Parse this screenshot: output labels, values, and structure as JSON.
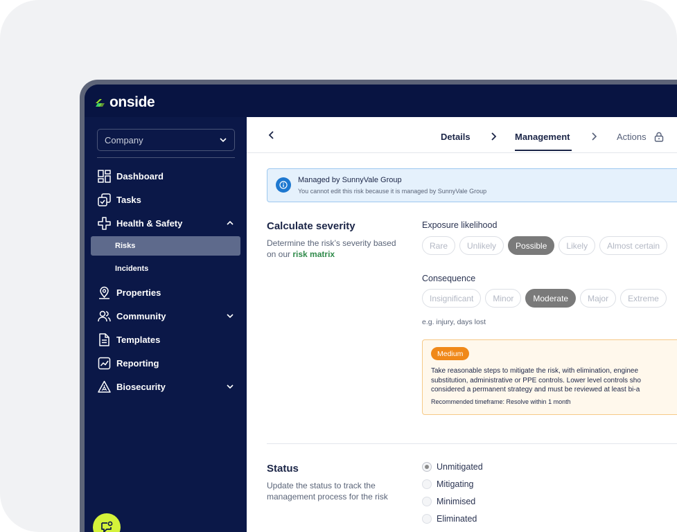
{
  "app": {
    "logo_text": "onside"
  },
  "sidebar": {
    "company_select": "Company",
    "items": [
      {
        "label": "Dashboard"
      },
      {
        "label": "Tasks"
      },
      {
        "label": "Health & Safety"
      },
      {
        "label": "Properties"
      },
      {
        "label": "Community"
      },
      {
        "label": "Templates"
      },
      {
        "label": "Reporting"
      },
      {
        "label": "Biosecurity"
      }
    ],
    "sub_items": [
      {
        "label": "Risks",
        "active": true
      },
      {
        "label": "Incidents",
        "active": false
      }
    ]
  },
  "steps": {
    "details": "Details",
    "management": "Management",
    "actions": "Actions"
  },
  "banner": {
    "title": "Managed by SunnyVale Group",
    "subtitle": "You cannot edit this risk because it is managed by SunnyVale Group"
  },
  "severity": {
    "title": "Calculate severity",
    "desc_prefix": "Determine the risk’s severity based on our",
    "desc_link": "risk matrix",
    "likelihood_label": "Exposure likelihood",
    "likelihood_options": [
      "Rare",
      "Unlikely",
      "Possible",
      "Likely",
      "Almost certain"
    ],
    "likelihood_selected": "Possible",
    "consequence_label": "Consequence",
    "consequence_options": [
      "Insignificant",
      "Minor",
      "Moderate",
      "Major",
      "Extreme"
    ],
    "consequence_selected": "Moderate",
    "consequence_hint": "e.g. injury, days lost",
    "result_badge": "Medium",
    "result_line1": "Take reasonable steps to mitigate the risk, with elimination, enginee",
    "result_line2": "substitution, administrative or PPE controls. Lower level controls sho",
    "result_line3": "considered a permanent strategy and must be reviewed at least bi-a",
    "result_timeframe": "Recommended timeframe: Resolve within 1 month"
  },
  "status": {
    "title": "Status",
    "desc": "Update the status to track the management process for the risk",
    "options": [
      "Unmitigated",
      "Mitigating",
      "Minimised",
      "Eliminated"
    ],
    "selected": "Unmitigated"
  },
  "colors": {
    "sidebar_bg": "#0b1848",
    "accent_green": "#2f8a4a",
    "lime": "#d4f23a",
    "medium_orange": "#f0891a"
  }
}
